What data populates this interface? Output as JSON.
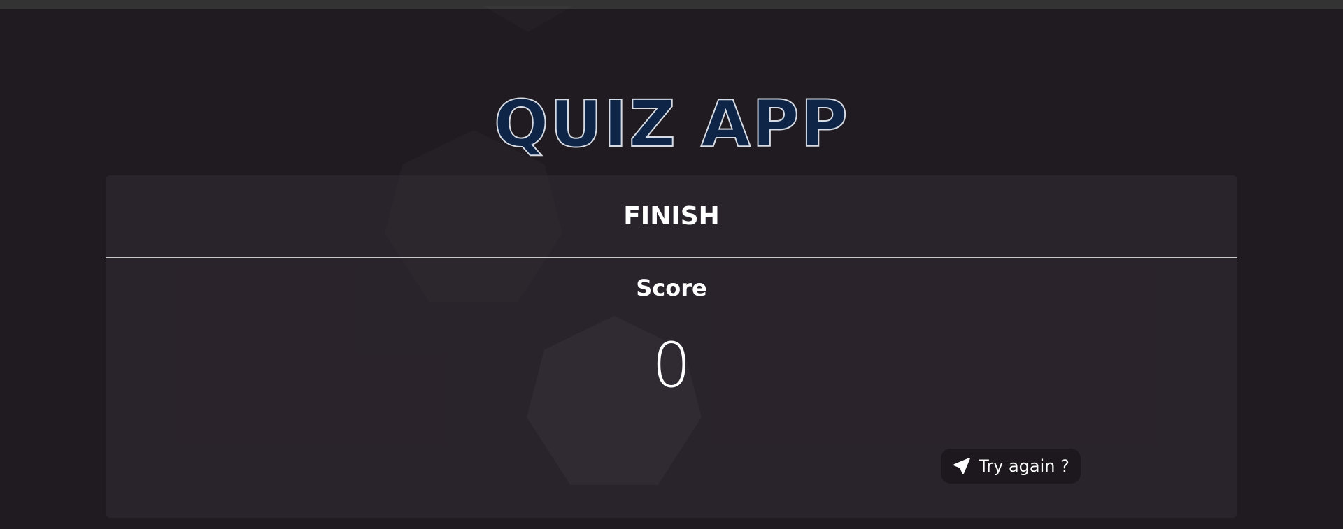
{
  "app": {
    "title": "QUIZ APP",
    "colors": {
      "background": "#201a21",
      "title_fill": "#0e2547",
      "title_outline": "#d6dbe3",
      "card": "#2a242c",
      "button": "#1c181d",
      "text": "#ffffff"
    }
  },
  "card": {
    "header": "FINISH",
    "score_label": "Score",
    "score_value": "0"
  },
  "actions": {
    "try_again_label": "Try again ?",
    "try_again_icon": "send-icon"
  }
}
